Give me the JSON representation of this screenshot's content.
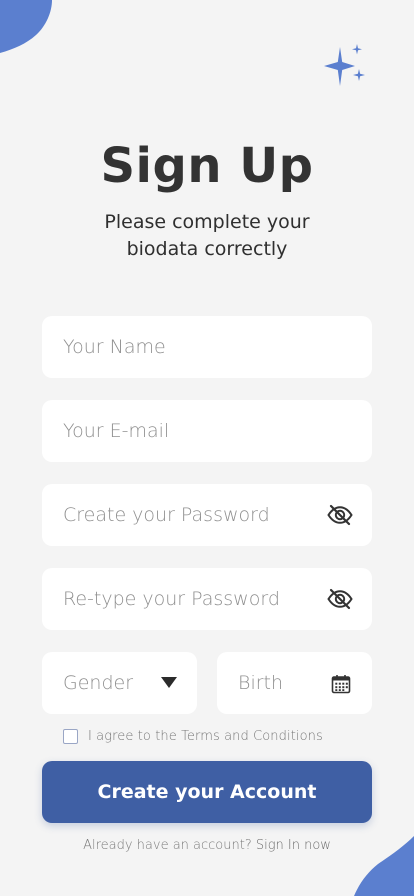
{
  "colors": {
    "background": "#f4f4f4",
    "accent": "#3f5fa4",
    "sparkle": "#5b7fcf",
    "blob": "#5b7fcf"
  },
  "header": {
    "title": "Sign Up",
    "subtitle_line1": "Please complete your",
    "subtitle_line2": "biodata correctly"
  },
  "form": {
    "name_placeholder": "Your Name",
    "email_placeholder": "Your E-mail",
    "password_placeholder": "Create your Password",
    "retype_placeholder": "Re-type your Password",
    "gender_placeholder": "Gender",
    "birth_placeholder": "Birth"
  },
  "agreement": {
    "label": "I agree to the Terms and Conditions"
  },
  "actions": {
    "create_label": "Create your Account",
    "signin_prefix": "Already have an account? ",
    "signin_link": "Sign In now"
  },
  "icons": {
    "password_visibility": "eye-off-icon",
    "retype_visibility": "eye-off-icon",
    "gender_dropdown": "caret-down-icon",
    "birth_picker": "calendar-icon",
    "decoration": "sparkles-icon"
  }
}
